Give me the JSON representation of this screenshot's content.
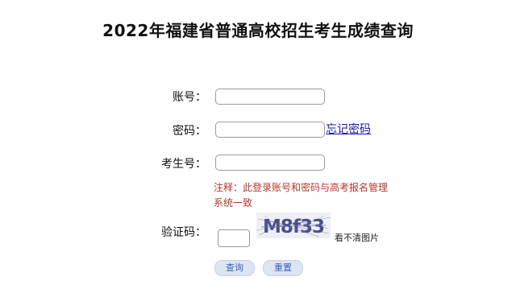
{
  "page_title": "2022年福建省普通高校招生考生成绩查询",
  "form": {
    "account_label": "账号：",
    "password_label": "密码：",
    "exam_number_label": "考生号：",
    "captcha_label": "验证码：",
    "forgot_password": "忘记密码",
    "note": "注释：此登录账号和密码与高考报名管理系统一致",
    "captcha_text": "M8f33",
    "captcha_refresh": "看不清图片",
    "account_value": "",
    "password_value": "",
    "exam_number_value": "",
    "captcha_value": ""
  },
  "buttons": {
    "query": "查询",
    "reset": "重置"
  },
  "colors": {
    "note_red": "#b5362e",
    "link_blue": "#1a1aa6",
    "button_bg": "#dde4f2",
    "button_text": "#3d63b8"
  }
}
